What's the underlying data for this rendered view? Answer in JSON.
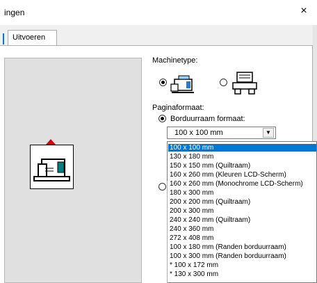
{
  "window": {
    "title": "ingen",
    "close_glyph": "×"
  },
  "tabs": [
    {
      "label": "Uitvoeren"
    }
  ],
  "machine": {
    "label": "Machinetype:",
    "selected": "embroidery-machine"
  },
  "page": {
    "label": "Paginaformaat:",
    "hoop_radio_label": "Borduurraam formaat:",
    "selected_value": "100 x 100 mm",
    "options": [
      "100 x 100 mm",
      "130 x 180 mm",
      "150 x 150 mm (Quiltraam)",
      "160 x 260 mm (Kleuren LCD-Scherm)",
      "160 x 260 mm (Monochrome LCD-Scherm)",
      "180 x 300 mm",
      "200 x 200 mm (Quiltraam)",
      "200 x 300 mm",
      "240 x 240 mm (Quiltraam)",
      "240 x 360 mm",
      "272 x 408 mm",
      "100 x 180 mm (Randen borduurraam)",
      "100 x 300 mm (Randen borduurraam)",
      "* 100 x 172 mm",
      "* 130 x 300 mm"
    ]
  },
  "colors": {
    "selection": "#0078d7",
    "hoop_marker": "#e00000",
    "machine_accent": "#008080"
  }
}
